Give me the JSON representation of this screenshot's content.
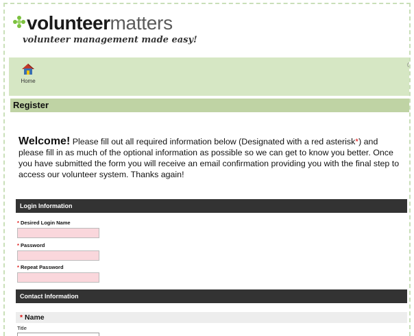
{
  "brand": {
    "bold": "volunteer",
    "light": "matters",
    "tagline": "volunteer management made easy!"
  },
  "nav": {
    "home_label": "Home",
    "count": "0"
  },
  "page": {
    "title": "Register"
  },
  "welcome": {
    "lead": "Welcome!",
    "text1": " Please fill out all required information below (Designated with a red asterisk",
    "asterisk": "*",
    "text2": ") and please fill in as much of the optional information as possible so we can get to know you better. Once you have submitted the form you will receive an email confirmation providing you with the final step to access our volunteer system. Thanks again!"
  },
  "login": {
    "header": "Login Information",
    "fields": [
      {
        "required": "*",
        "label": "Desired Login Name",
        "value": ""
      },
      {
        "required": "*",
        "label": "Password",
        "value": ""
      },
      {
        "required": "*",
        "label": "Repeat Password",
        "value": ""
      }
    ]
  },
  "contact": {
    "header": "Contact Information",
    "name_required": "*",
    "name_label": "Name",
    "title_label": "Title",
    "title_value": ""
  },
  "colors": {
    "accent": "#d6e7c4",
    "required": "#dd1111",
    "section": "#333333"
  },
  "icons": [
    "flower-icon",
    "home-icon"
  ]
}
